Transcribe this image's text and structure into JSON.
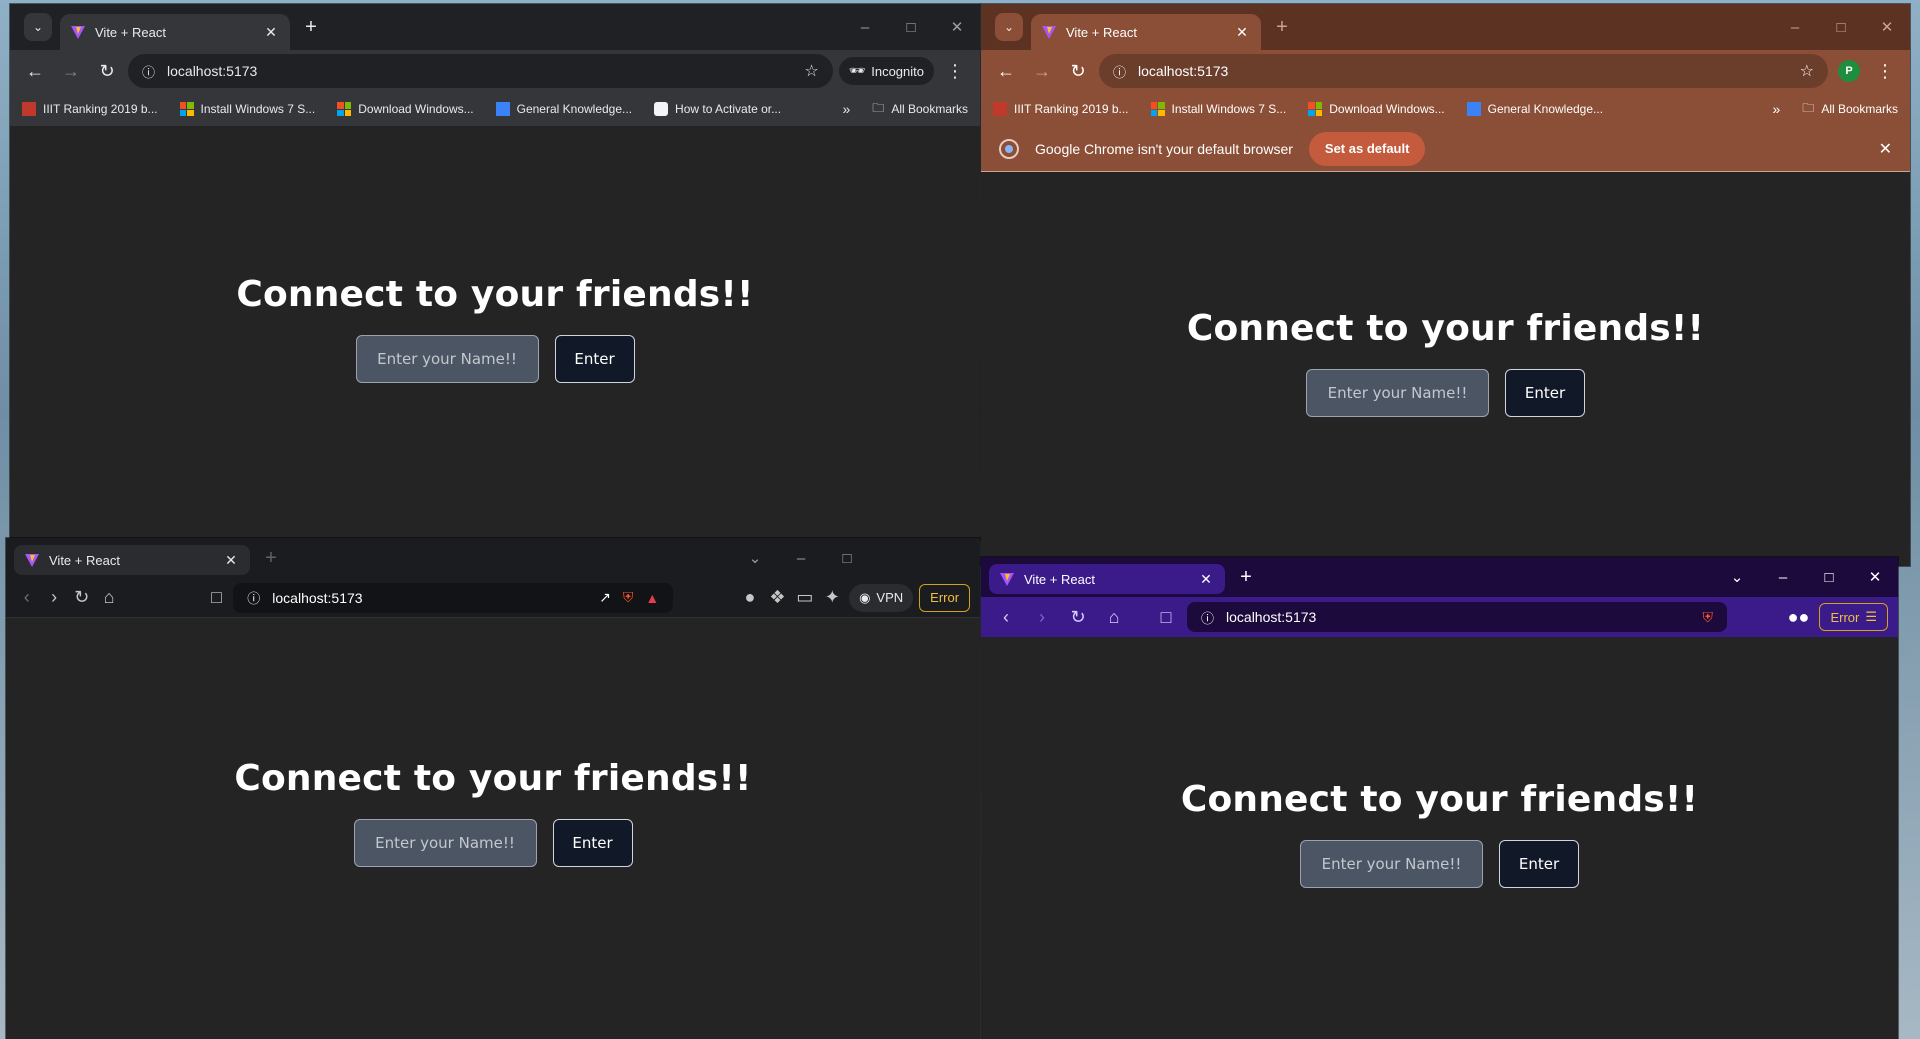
{
  "common": {
    "tab_title": "Vite + React",
    "url": "localhost:5173",
    "page": {
      "heading": "Connect to your friends!!",
      "input_placeholder": "Enter your Name!!",
      "button_label": "Enter"
    }
  },
  "chrome_incognito": {
    "incognito_label": "Incognito",
    "bookmarks": [
      "IIIT Ranking 2019 b...",
      "Install Windows 7 S...",
      "Download Windows...",
      "General Knowledge...",
      "How to Activate or..."
    ],
    "all_bookmarks": "All Bookmarks"
  },
  "chrome_default": {
    "avatar_letter": "P",
    "bookmarks": [
      "IIIT Ranking 2019 b...",
      "Install Windows 7 S...",
      "Download Windows...",
      "General Knowledge..."
    ],
    "all_bookmarks": "All Bookmarks",
    "infobar_text": "Google Chrome isn't your default browser",
    "infobar_button": "Set as default"
  },
  "brave_dark": {
    "vpn_label": "VPN",
    "error_label": "Error"
  },
  "brave_private": {
    "error_label": "Error"
  },
  "colors": {
    "page_bg": "#242424",
    "chrome_dark_frame": "#202124",
    "chrome_brown_frame": "#6b3d2b",
    "chrome_brown_toolbar": "#8b4e36",
    "brave_private_frame": "#1c0a3c",
    "brave_private_toolbar": "#3b1a8a",
    "set_default_button": "#c35b3c"
  }
}
